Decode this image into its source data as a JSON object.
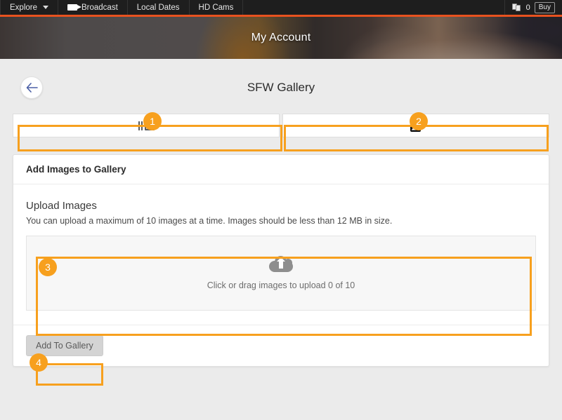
{
  "topnav": {
    "items": [
      {
        "label": "Explore",
        "icon": "chevron-down-icon"
      },
      {
        "label": "Broadcast",
        "icon": "video-camera-icon"
      },
      {
        "label": "Local Dates",
        "icon": ""
      },
      {
        "label": "HD Cams",
        "icon": ""
      }
    ],
    "credits": {
      "icon": "coins-icon",
      "count": "0",
      "buy_label": "Buy"
    }
  },
  "banner": {
    "title": "My Account"
  },
  "page": {
    "back_icon": "arrow-left-icon",
    "title": "SFW Gallery"
  },
  "tabs": [
    {
      "name": "gallery-images-tab",
      "icon": "gallery-images-icon",
      "label": ""
    },
    {
      "name": "add-images-tab",
      "icon": "add-image-icon",
      "label": ""
    }
  ],
  "card": {
    "header": "Add Images to Gallery",
    "section_title": "Upload Images",
    "section_desc": "You can upload a maximum of 10 images at a time. Images should be less than 12 MB in size.",
    "dropzone": {
      "icon": "cloud-upload-icon",
      "text": "Click or drag images to upload 0 of 10"
    },
    "submit_label": "Add To Gallery"
  },
  "annotations": [
    {
      "number": "1",
      "target": "gallery-images-tab"
    },
    {
      "number": "2",
      "target": "add-images-tab"
    },
    {
      "number": "3",
      "target": "upload-dropzone"
    },
    {
      "number": "4",
      "target": "add-to-gallery-button"
    }
  ],
  "colors": {
    "accent": "#f7a01e",
    "nav_underline": "#e8521f",
    "page_bg": "#ebebeb",
    "nav_bg": "#1e1e1e"
  }
}
